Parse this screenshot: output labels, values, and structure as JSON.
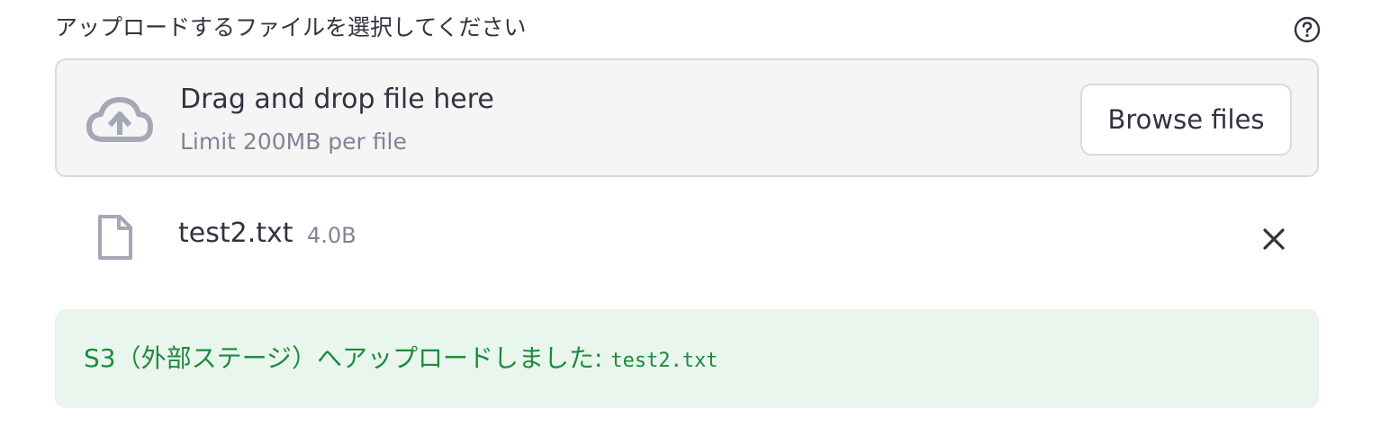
{
  "uploader": {
    "label": "アップロードするファイルを選択してください",
    "help_icon": "help-circle-icon",
    "dropzone": {
      "icon": "cloud-upload-icon",
      "title": "Drag and drop file here",
      "limit": "Limit 200MB per file",
      "browse_label": "Browse files"
    }
  },
  "file": {
    "icon": "file-icon",
    "name": "test2.txt",
    "size": "4.0B",
    "remove_icon": "close-icon"
  },
  "alert": {
    "message": "S3（外部ステージ）へアップロードしました: ",
    "filename": "test2.txt",
    "text_color": "#1e8a3c",
    "background_color": "#e8f6ed"
  }
}
